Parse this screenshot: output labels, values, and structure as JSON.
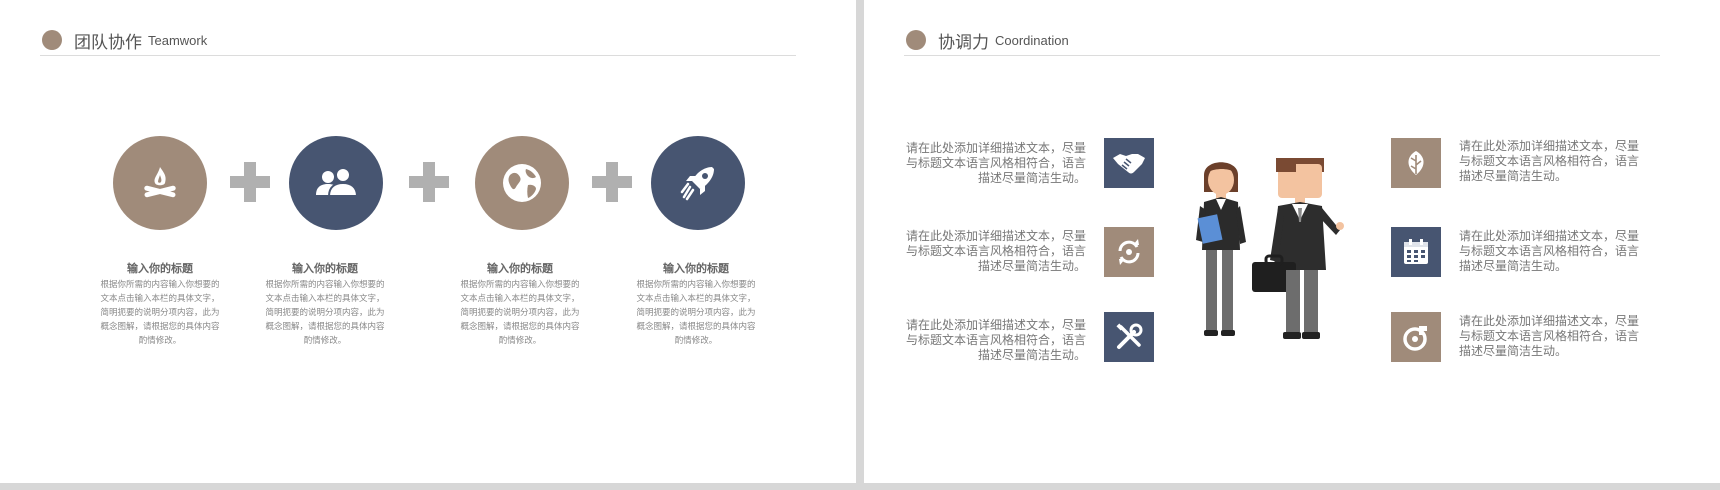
{
  "left_slide": {
    "header": {
      "title_cn": "团队协作",
      "title_en": "Teamwork"
    },
    "items": [
      {
        "icon": "campfire-icon",
        "title": "输入你的标题",
        "description": "根据你所需的内容输入你想要的文本点击输入本栏的具体文字，简明扼要的说明分项内容，此为概念图解，请根据您的具体内容酌情修改。"
      },
      {
        "icon": "users-icon",
        "title": "输入你的标题",
        "description": "根据你所需的内容输入你想要的文本点击输入本栏的具体文字，简明扼要的说明分项内容，此为概念图解，请根据您的具体内容酌情修改。"
      },
      {
        "icon": "globe-icon",
        "title": "输入你的标题",
        "description": "根据你所需的内容输入你想要的文本点击输入本栏的具体文字，简明扼要的说明分项内容，此为概念图解，请根据您的具体内容酌情修改。"
      },
      {
        "icon": "rocket-icon",
        "title": "输入你的标题",
        "description": "根据你所需的内容输入你想要的文本点击输入本栏的具体文字，简明扼要的说明分项内容，此为概念图解，请根据您的具体内容酌情修改。"
      }
    ]
  },
  "right_slide": {
    "header": {
      "title_cn": "协调力",
      "title_en": "Coordination"
    },
    "left_items": [
      {
        "icon": "handshake-icon",
        "text": "请在此处添加详细描述文本，尽量与标题文本语言风格相符合，语言描述尽量简洁生动。"
      },
      {
        "icon": "refresh-icon",
        "text": "请在此处添加详细描述文本，尽量与标题文本语言风格相符合，语言描述尽量简洁生动。"
      },
      {
        "icon": "tools-icon",
        "text": "请在此处添加详细描述文本，尽量与标题文本语言风格相符合，语言描述尽量简洁生动。"
      }
    ],
    "right_items": [
      {
        "icon": "leaf-icon",
        "text": "请在此处添加详细描述文本，尽量与标题文本语言风格相符合，语言描述尽量简洁生动。"
      },
      {
        "icon": "calendar-icon",
        "text": "请在此处添加详细描述文本，尽量与标题文本语言风格相符合，语言描述尽量简洁生动。"
      },
      {
        "icon": "music-icon",
        "text": "请在此处添加详细描述文本，尽量与标题文本语言风格相符合，语言描述尽量简洁生动。"
      }
    ]
  },
  "colors": {
    "brown": "#a08b7a",
    "navy": "#475571",
    "plus_gray": "#b0b0b0",
    "text": "#666666"
  }
}
